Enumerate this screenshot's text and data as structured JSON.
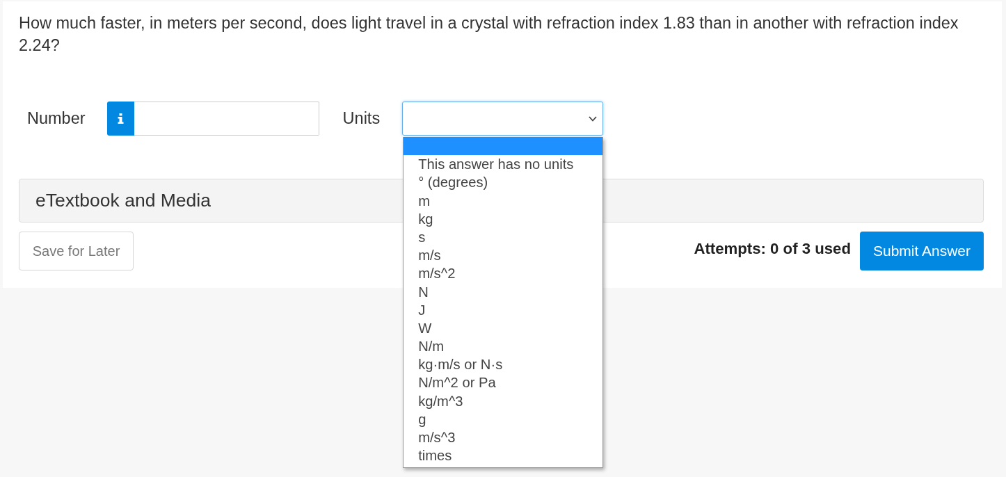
{
  "question": {
    "text": "How much faster, in meters per second, does light travel in a crystal with refraction index 1.83 than in another with refraction index 2.24?"
  },
  "answer": {
    "number": {
      "label": "Number"
    },
    "units": {
      "label": "Units",
      "expanded": true,
      "options": [
        {
          "selected": true
        },
        {
          "label": "This answer has no units",
          "selected": false
        },
        {
          "label": "° (degrees)",
          "selected": false
        },
        {
          "label": "m",
          "selected": false
        },
        {
          "label": "kg",
          "selected": false
        },
        {
          "label": "s",
          "selected": false
        },
        {
          "label": "m/s",
          "selected": false
        },
        {
          "label": "m/s^2",
          "selected": false
        },
        {
          "label": "N",
          "selected": false
        },
        {
          "label": "J",
          "selected": false
        },
        {
          "label": "W",
          "selected": false
        },
        {
          "label": "N/m",
          "selected": false
        },
        {
          "label": "kg·m/s or N·s",
          "selected": false
        },
        {
          "label": "N/m^2 or Pa",
          "selected": false
        },
        {
          "label": "kg/m^3",
          "selected": false
        },
        {
          "label": "g",
          "selected": false
        },
        {
          "label": "m/s^3",
          "selected": false
        },
        {
          "label": "times",
          "selected": false
        }
      ]
    }
  },
  "media_section": {
    "title": "eTextbook and Media"
  },
  "footer": {
    "save_button": "Save for Later",
    "attempts": "Attempts: 0 of 3 used",
    "submit_button": "Submit Answer"
  }
}
